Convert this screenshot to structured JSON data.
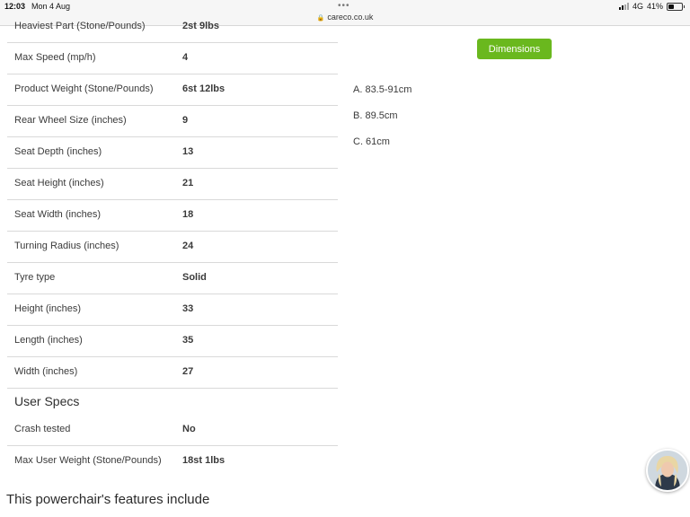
{
  "status_bar": {
    "time": "12:03",
    "date": "Mon 4 Aug",
    "dots": "•••",
    "url": "careco.co.uk",
    "network": "4G",
    "battery": "41%",
    "battery_level": 0.41
  },
  "specs": [
    {
      "label": "Heaviest Part (Stone/Pounds)",
      "value": "2st 9lbs"
    },
    {
      "label": "Max Speed (mp/h)",
      "value": "4"
    },
    {
      "label": "Product Weight (Stone/Pounds)",
      "value": "6st 12lbs"
    },
    {
      "label": "Rear Wheel Size (inches)",
      "value": "9"
    },
    {
      "label": "Seat Depth (inches)",
      "value": "13"
    },
    {
      "label": "Seat Height (inches)",
      "value": "21"
    },
    {
      "label": "Seat Width (inches)",
      "value": "18"
    },
    {
      "label": "Turning Radius (inches)",
      "value": "24"
    },
    {
      "label": "Tyre type",
      "value": "Solid"
    },
    {
      "label": "Height (inches)",
      "value": "33"
    },
    {
      "label": "Length (inches)",
      "value": "35"
    },
    {
      "label": "Width (inches)",
      "value": "27"
    }
  ],
  "user_specs": {
    "title": "User Specs",
    "rows": [
      {
        "label": "Crash tested",
        "value": "No"
      },
      {
        "label": "Max User Weight (Stone/Pounds)",
        "value": "18st 1lbs"
      }
    ]
  },
  "features_heading": "This powerchair's features include",
  "dimensions": {
    "button_label": "Dimensions",
    "button_color": "#6ab81e",
    "items": [
      "A. 83.5-91cm",
      "B. 89.5cm",
      "C. 61cm"
    ]
  },
  "chat_avatar": {
    "icon": "support-agent-avatar"
  }
}
